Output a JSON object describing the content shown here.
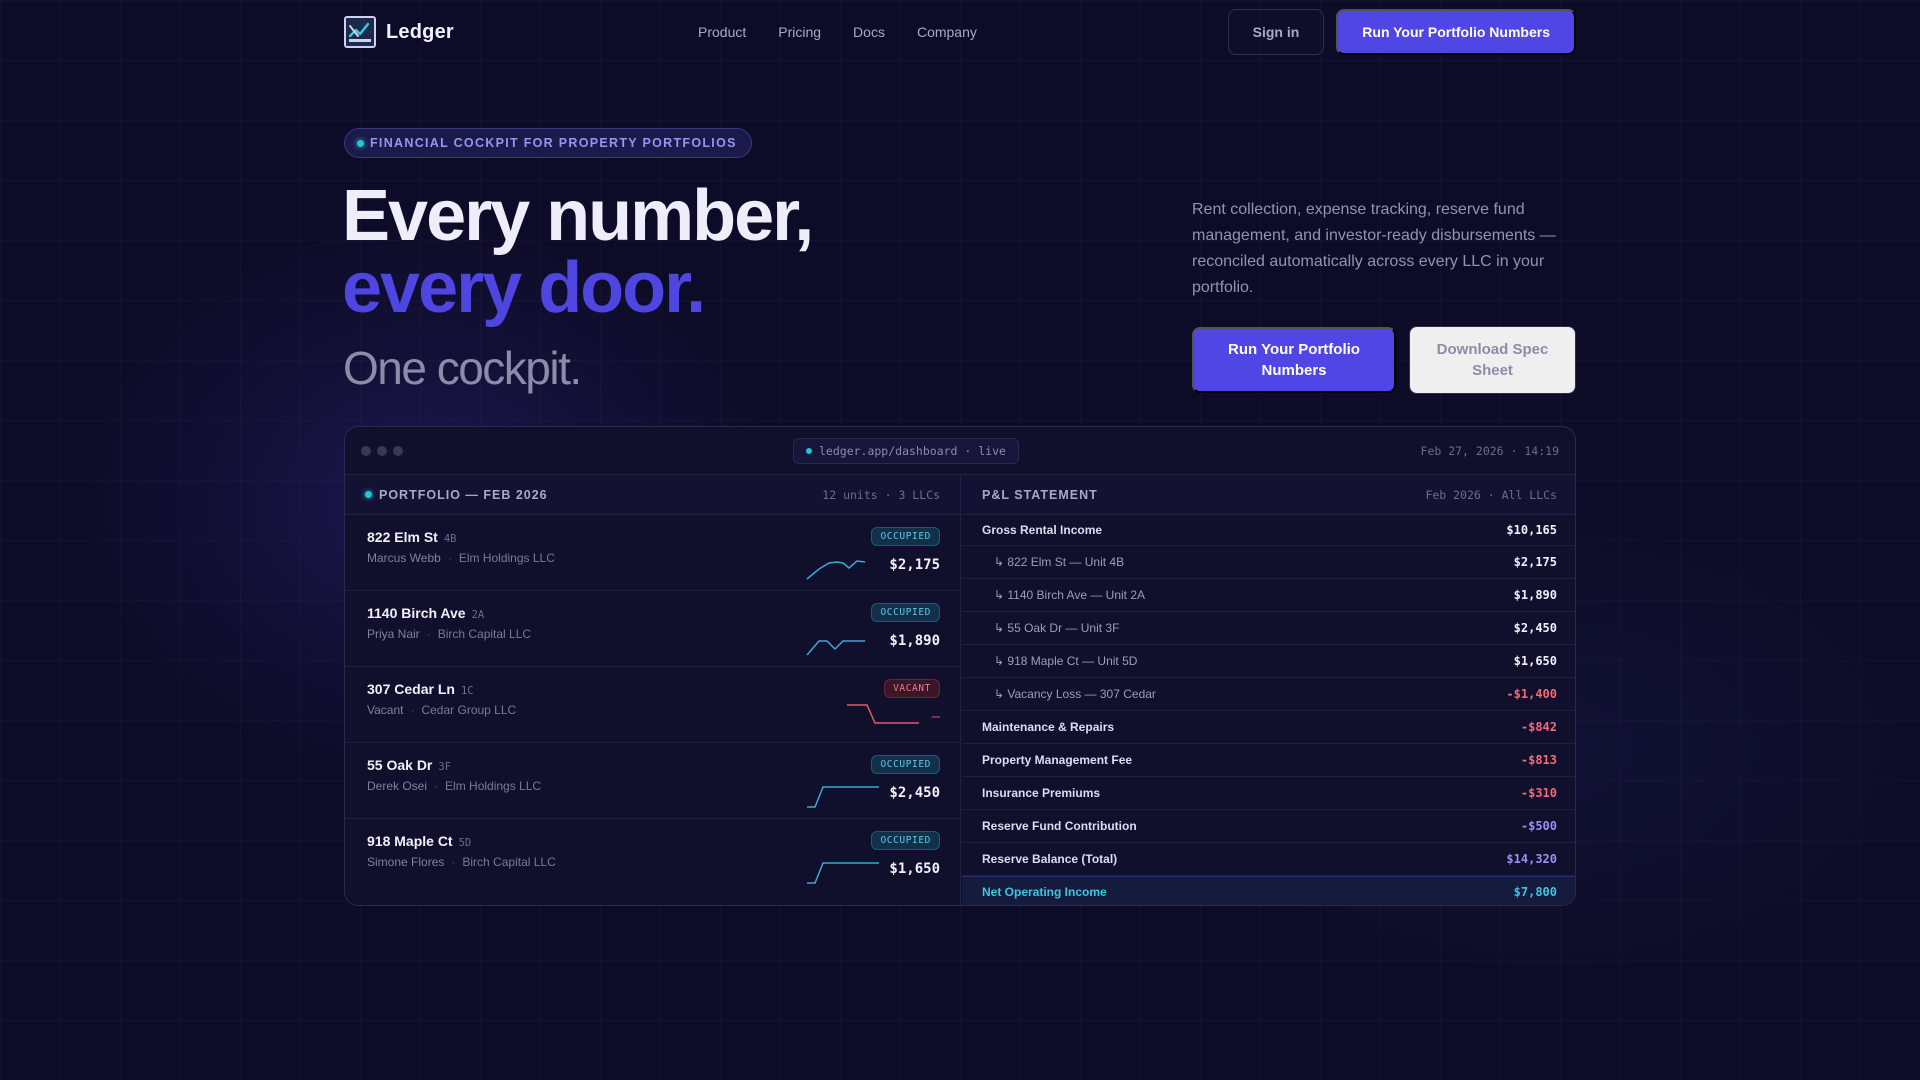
{
  "brand": {
    "name": "Ledger"
  },
  "nav": {
    "links": [
      "Product",
      "Pricing",
      "Docs",
      "Company"
    ],
    "signin_label": "Sign in",
    "cta_label": "Run Your Portfolio Numbers"
  },
  "hero": {
    "eyebrow": "FINANCIAL COCKPIT FOR PROPERTY PORTFOLIOS",
    "headline_line1": "Every number,",
    "headline_line2": "every door.",
    "subheadline": "One cockpit.",
    "lede": "Rent collection, expense tracking, reserve fund management, and investor-ready disbursements — reconciled automatically across every LLC in your portfolio.",
    "primary_cta": "Run Your Portfolio Numbers",
    "secondary_cta": "Download Spec Sheet"
  },
  "dashboard": {
    "url": "ledger.app/dashboard · live",
    "timestamp": "Feb 27, 2026 · 14:19",
    "portfolio": {
      "title": "PORTFOLIO — FEB 2026",
      "meta": "12 units · 3 LLCs",
      "properties": [
        {
          "address": "822 Elm St",
          "unit": "4B",
          "tenant": "Marcus Webb",
          "llc": "Elm Holdings LLC",
          "status": "OCCUPIED",
          "rent": "$2,175"
        },
        {
          "address": "1140 Birch Ave",
          "unit": "2A",
          "tenant": "Priya Nair",
          "llc": "Birch Capital LLC",
          "status": "OCCUPIED",
          "rent": "$1,890"
        },
        {
          "address": "307 Cedar Ln",
          "unit": "1C",
          "tenant": "Vacant",
          "llc": "Cedar Group LLC",
          "status": "VACANT",
          "rent": "—"
        },
        {
          "address": "55 Oak Dr",
          "unit": "3F",
          "tenant": "Derek Osei",
          "llc": "Elm Holdings LLC",
          "status": "OCCUPIED",
          "rent": "$2,450"
        },
        {
          "address": "918 Maple Ct",
          "unit": "5D",
          "tenant": "Simone Flores",
          "llc": "Birch Capital LLC",
          "status": "OCCUPIED",
          "rent": "$1,650"
        }
      ]
    },
    "pl": {
      "title": "P&L STATEMENT",
      "meta": "Feb 2026 · All LLCs",
      "rows": [
        {
          "label": "Gross Rental Income",
          "value": "$10,165"
        },
        {
          "label": "↳ 822 Elm St — Unit 4B",
          "value": "$2,175"
        },
        {
          "label": "↳ 1140 Birch Ave — Unit 2A",
          "value": "$1,890"
        },
        {
          "label": "↳ 55 Oak Dr — Unit 3F",
          "value": "$2,450"
        },
        {
          "label": "↳ 918 Maple Ct — Unit 5D",
          "value": "$1,650"
        },
        {
          "label": "↳ Vacancy Loss — 307 Cedar",
          "value": "-$1,400"
        },
        {
          "label": "Maintenance & Repairs",
          "value": "-$842"
        },
        {
          "label": "Property Management Fee",
          "value": "-$813"
        },
        {
          "label": "Insurance Premiums",
          "value": "-$310"
        },
        {
          "label": "Reserve Fund Contribution",
          "value": "-$500"
        },
        {
          "label": "Reserve Balance (Total)",
          "value": "$14,320"
        },
        {
          "label": "Net Operating Income",
          "value": "$7,800"
        }
      ]
    }
  },
  "colors": {
    "background": "#0d0c28",
    "accent": "#5046e5",
    "accent_text": "#4f45e0",
    "occupied": "#5ec9e6",
    "vacant": "#f27a8a",
    "negative": "#f36a7a",
    "reserve": "#9d8ff4",
    "noi": "#3ec6e0"
  }
}
